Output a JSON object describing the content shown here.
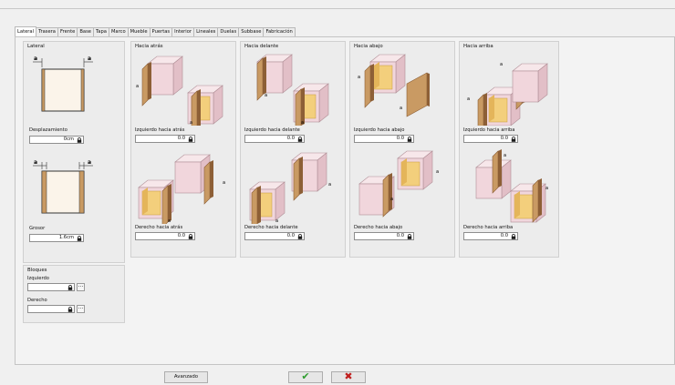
{
  "tabs": [
    "Lateral",
    "Trasera",
    "Frente",
    "Base",
    "Tapa",
    "Marco",
    "Mueble",
    "Puertas",
    "Interior",
    "Lineales",
    "Duelas",
    "Subbase",
    "Fabricación"
  ],
  "lateral": {
    "title": "Lateral",
    "offset_label": "Desplazamiento",
    "offset_value": "0cm",
    "thickness_label": "Grosor",
    "thickness_value": "1.6cm",
    "dim_mark": "a"
  },
  "groups": [
    {
      "title": "Hacia atrás",
      "left_label": "Izquierdo hacia atrás",
      "left_value": "0.0",
      "right_label": "Derecho hacia atrás",
      "right_value": "0.0"
    },
    {
      "title": "Hacia delante",
      "left_label": "Izquierdo hacia delante",
      "left_value": "0.0",
      "right_label": "Derecho hacia delante",
      "right_value": "0.0"
    },
    {
      "title": "Hacia abajo",
      "left_label": "Izquierdo hacia abajo",
      "left_value": "0.0",
      "right_label": "Derecho hacia abajo",
      "right_value": "0.0"
    },
    {
      "title": "Hacia arriba",
      "left_label": "Izquierdo hacia arriba",
      "left_value": "0.0",
      "right_label": "Derecho hacia arriba",
      "right_value": "0.0"
    }
  ],
  "blocks": {
    "title": "Bloques",
    "left_label": "Izquierdo",
    "left_value": "",
    "right_label": "Derecho",
    "right_value": "",
    "browse_label": "..."
  },
  "footer": {
    "advanced_label": "Avanzado",
    "ok_glyph": "✔",
    "cancel_glyph": "✖"
  },
  "colors": {
    "panel_wood": "#c99a63",
    "panel_wood_dark": "#8d5f36",
    "cabinet_pink": "#f1d6dc",
    "cabinet_edge": "#b08e96",
    "interior_yellow": "#f3cf7c",
    "ok_green": "#2e9c2e",
    "cancel_red": "#c0201f"
  }
}
